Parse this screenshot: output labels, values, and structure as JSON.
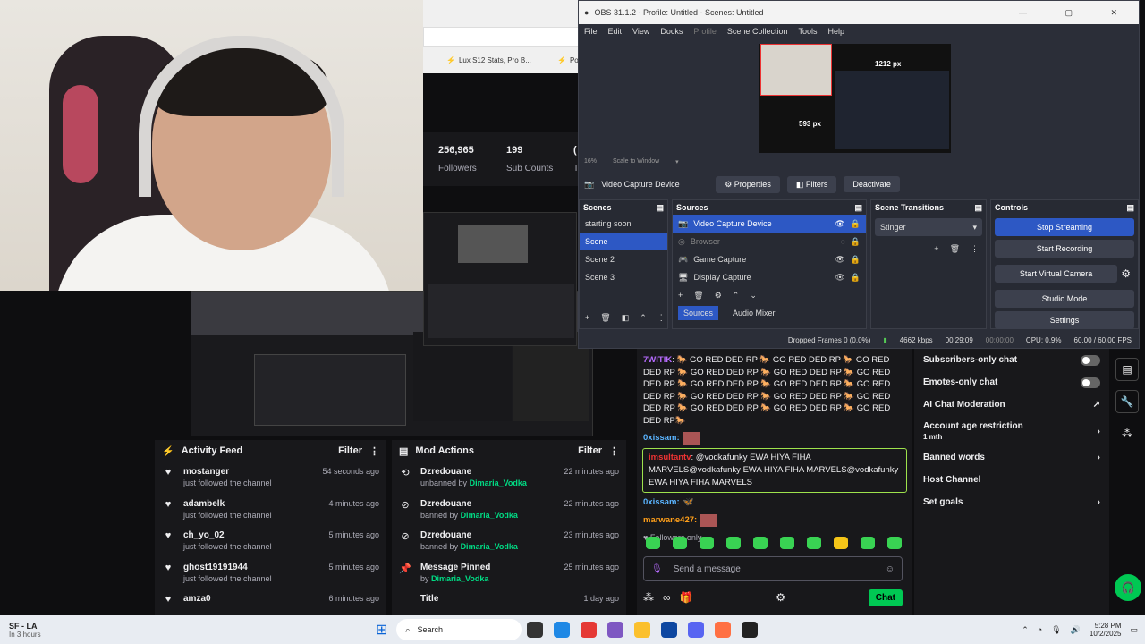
{
  "browser": {
    "tabs": [
      "Lux S12 Stats, Pro B...",
      "Po"
    ]
  },
  "stats": [
    {
      "value": "256,965",
      "label": "Followers"
    },
    {
      "value": "199",
      "label": "Sub Counts"
    },
    {
      "value": "(",
      "label": "T"
    }
  ],
  "obs": {
    "title": "OBS 31.1.2 - Profile: Untitled - Scenes: Untitled",
    "menu": [
      "File",
      "Edit",
      "View",
      "Docks",
      "Profile",
      "Scene Collection",
      "Tools",
      "Help"
    ],
    "preview_w": "1212 px",
    "preview_h": "593 px",
    "zoom": "16%",
    "scale": "Scale to Window",
    "selected_source": "Video Capture Device",
    "props": "Properties",
    "filters": "Filters",
    "deactivate": "Deactivate",
    "scenes_title": "Scenes",
    "scenes": [
      "starting soon",
      "Scene",
      "Scene 2",
      "Scene 3"
    ],
    "sources_title": "Sources",
    "sources": [
      "Video Capture Device",
      "Browser",
      "Game Capture",
      "Display Capture"
    ],
    "tab_sources": "Sources",
    "tab_mixer": "Audio Mixer",
    "transitions_title": "Scene Transitions",
    "transition": "Stinger",
    "controls_title": "Controls",
    "controls": [
      "Stop Streaming",
      "Start Recording",
      "Start Virtual Camera",
      "Studio Mode",
      "Settings"
    ],
    "status": {
      "dropped": "Dropped Frames 0 (0.0%)",
      "kbps": "4662 kbps",
      "live": "00:29:09",
      "rec": "00:00:00",
      "cpu": "CPU: 0.9%",
      "fps": "60.00 / 60.00 FPS"
    }
  },
  "activity": {
    "title": "Activity Feed",
    "filter": "Filter",
    "items": [
      {
        "name": "mostanger",
        "sub": "just followed the channel",
        "time": "54 seconds ago"
      },
      {
        "name": "adambelk",
        "sub": "just followed the channel",
        "time": "4 minutes ago"
      },
      {
        "name": "ch_yo_02",
        "sub": "just followed the channel",
        "time": "5 minutes ago"
      },
      {
        "name": "ghost19191944",
        "sub": "just followed the channel",
        "time": "5 minutes ago"
      },
      {
        "name": "amza0",
        "sub": "",
        "time": "6 minutes ago"
      }
    ]
  },
  "mod": {
    "title": "Mod Actions",
    "filter": "Filter",
    "items": [
      {
        "name": "Dzredouane",
        "sub": "unbanned by",
        "by": "Dimaria_Vodka",
        "time": "22 minutes ago"
      },
      {
        "name": "Dzredouane",
        "sub": "banned by",
        "by": "Dimaria_Vodka",
        "time": "22 minutes ago"
      },
      {
        "name": "Dzredouane",
        "sub": "banned by",
        "by": "Dimaria_Vodka",
        "time": "23 minutes ago"
      },
      {
        "name": "Message Pinned",
        "sub": "by",
        "by": "Dimaria_Vodka",
        "time": "25 minutes ago"
      },
      {
        "name": "Title",
        "sub": "",
        "by": "",
        "time": "1 day ago"
      }
    ]
  },
  "chat": {
    "msg1_user": "7WITIK",
    "msg1_text": "🐎 GO RED DED RP 🐎 GO RED DED RP 🐎 GO RED DED RP 🐎 GO RED DED RP 🐎 GO RED DED RP 🐎 GO RED DED RP 🐎 GO RED DED RP 🐎 GO RED DED RP 🐎 GO RED DED RP 🐎 GO RED DED RP 🐎 GO RED DED RP 🐎 GO RED DED RP 🐎 GO RED DED RP 🐎 GO RED DED RP 🐎 GO RED DED RP🐎",
    "msg2_user": "0xissam:",
    "hl_user": "imsultantv",
    "hl_text": "@vodkafunky EWA HIYA FIHA MARVELS@vodkafunky EWA HIYA FIHA MARVELS@vodkafunky EWA HIYA FIHA MARVELS",
    "msg3_user": "0xissam:",
    "msg4_user": "marwane427:",
    "followers_only": "Followers only",
    "placeholder": "Send a message",
    "chat_btn": "Chat"
  },
  "settings": {
    "rows": [
      {
        "label": "Subscribers-only chat",
        "type": "toggle"
      },
      {
        "label": "Emotes-only chat",
        "type": "toggle"
      },
      {
        "label": "AI Chat Moderation",
        "type": "link"
      },
      {
        "label": "Account age restriction",
        "sub": "1 mth",
        "type": "chevron"
      },
      {
        "label": "Banned words",
        "type": "chevron"
      },
      {
        "label": "Host Channel",
        "type": "none"
      },
      {
        "label": "Set goals",
        "type": "chevron"
      }
    ]
  },
  "taskbar": {
    "weather": "SF - LA",
    "weather_sub": "In 3 hours",
    "search": "Search",
    "time": "5:28 PM",
    "date": "10/2/2025"
  }
}
